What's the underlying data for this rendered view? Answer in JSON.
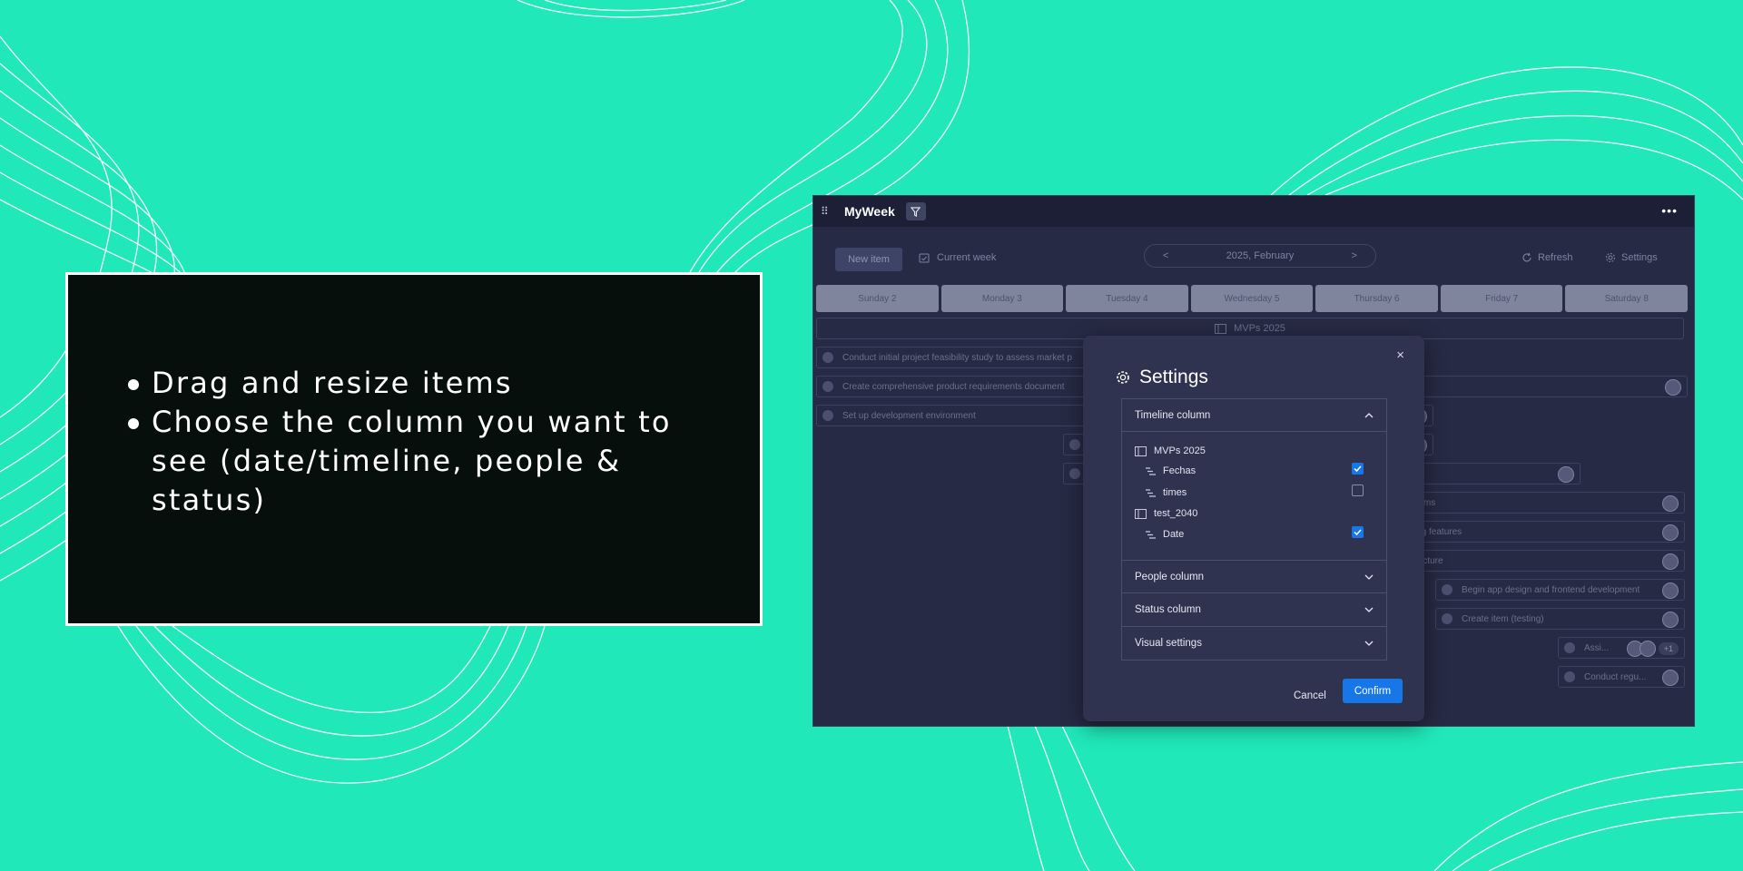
{
  "slide": {
    "bullets": [
      "Drag and resize items",
      "Choose the column you want to see (date/timeline, people & status)"
    ]
  },
  "app": {
    "title": "MyWeek",
    "toolbar": {
      "new_item": "New item",
      "current_week": "Current week",
      "month": "2025, February",
      "prev": "<",
      "next": ">",
      "refresh": "Refresh",
      "settings": "Settings"
    },
    "days": [
      "Sunday 2",
      "Monday 3",
      "Tuesday 4",
      "Wednesday 5",
      "Thursday 6",
      "Friday 7",
      "Saturday 8"
    ],
    "group": "MVPs 2025",
    "items": [
      "Conduct initial project feasibility study to assess market p",
      "Create comprehensive product requirements document",
      "Set up development environment",
      "chanisms",
      "racking features",
      "frastructure",
      "Begin app design and frontend development",
      "Create item (testing)",
      "Assi...",
      "Conduct regu..."
    ],
    "avatar_overflow": "+1"
  },
  "modal": {
    "title": "Settings",
    "close": "×",
    "sections": {
      "timeline": "Timeline column",
      "people": "People column",
      "status": "Status column",
      "visual": "Visual settings"
    },
    "tree": {
      "board1": "MVPs 2025",
      "fechas": "Fechas",
      "times": "times",
      "board2": "test_2040",
      "date": "Date"
    },
    "checks": {
      "fechas": true,
      "times": false,
      "date": true
    },
    "cancel": "Cancel",
    "confirm": "Confirm"
  },
  "colors": {
    "background": "#20E8B8",
    "card": "#070F0C",
    "app_bg": "#262A44",
    "modal_bg": "#30334F",
    "accent": "#1877E8"
  }
}
